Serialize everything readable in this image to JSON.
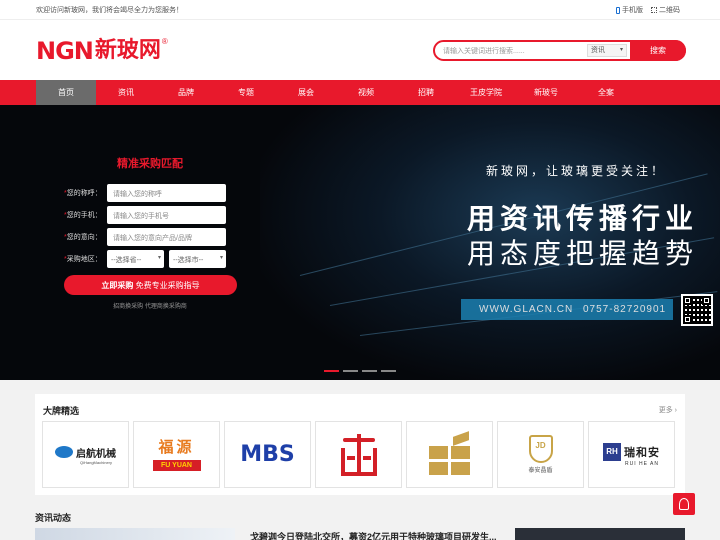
{
  "topbar": {
    "welcome": "欢迎访问新玻网，我们将会竭尽全力为您服务！",
    "mobile": "手机版",
    "qrcode": "二维码"
  },
  "logo": {
    "brand": "NGN",
    "name": "新玻网",
    "reg": "®"
  },
  "search": {
    "placeholder": "请输入关键词进行搜索......",
    "category": "资讯",
    "button": "搜索"
  },
  "nav": {
    "items": [
      "首页",
      "资讯",
      "品牌",
      "专题",
      "展会",
      "视频",
      "招聘",
      "王皮学院",
      "新玻号",
      "全案"
    ],
    "active": "首页"
  },
  "banner": {
    "slogan_top": "新玻网，让玻璃更受关注！",
    "slogan_line1": "用资讯传播行业",
    "slogan_line2": "用态度把握趋势",
    "url": "WWW.GLACN.CN",
    "tel": "0757-82720901",
    "slide_count": 4,
    "active_slide": 1
  },
  "form": {
    "title": "精准采购匹配",
    "star": "*",
    "name_label": "您的称呼：",
    "name_placeholder": "请输入您的称呼",
    "phone_label": "您的手机：",
    "phone_placeholder": "请输入您的手机号",
    "intent_label": "您的意向：",
    "intent_placeholder": "请输入您的意向产品/品牌",
    "region_label": "采购地区：",
    "province_placeholder": "--选择省--",
    "city_placeholder": "--选择市--",
    "submit_bold": "立即采购",
    "submit_rest": "免费专业采购指导",
    "note": "招商换采购 代理商换采购商"
  },
  "brands": {
    "heading": "大牌精选",
    "more": "更多 ›",
    "b1_name": "启航机械",
    "b1_sub": "QiHangMachinery",
    "b2_zh": "福源",
    "b2_en": "FU YUAN",
    "b3_name": "MBS",
    "b6_mark": "JD",
    "b6_name": "泰安晶盾",
    "b7_mark": "RH",
    "b7_zh": "瑞和安",
    "b7_en": "RUI HE AN"
  },
  "news": {
    "heading": "资讯动态",
    "headline": "戈碧迦今日登陆北交所，募资2亿元用于特种玻璃项目研发生..."
  },
  "colors": {
    "brand_red": "#e8192c",
    "nav_active": "#6b6b6b",
    "banner_bg": "#05070b"
  }
}
